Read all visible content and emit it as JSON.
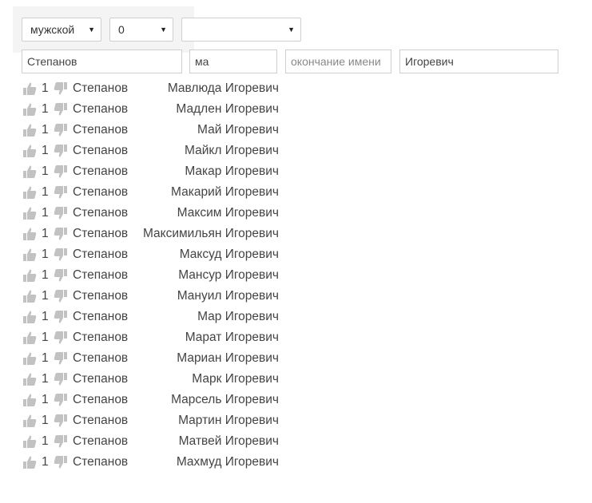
{
  "filters": {
    "gender": {
      "value": "мужской"
    },
    "count": {
      "value": "0"
    },
    "third": {
      "value": ""
    }
  },
  "inputs": {
    "surname": {
      "value": "Степанов"
    },
    "name_start": {
      "value": "ма"
    },
    "name_end": {
      "value": "",
      "placeholder": "окончание имени"
    },
    "patronymic": {
      "value": "Игоревич"
    }
  },
  "icons": {
    "like": "thumbs-up-icon",
    "dislike": "thumbs-down-icon",
    "dropdown": "chevron-down-icon"
  },
  "colors": {
    "icon": "#c2c2c2",
    "text": "#444444",
    "panel": "#f4f4f4"
  },
  "results": [
    {
      "votes": "1",
      "surname": "Степанов",
      "full_name": "Мавлюда Игоревич"
    },
    {
      "votes": "1",
      "surname": "Степанов",
      "full_name": "Мадлен Игоревич"
    },
    {
      "votes": "1",
      "surname": "Степанов",
      "full_name": "Май Игоревич"
    },
    {
      "votes": "1",
      "surname": "Степанов",
      "full_name": "Майкл Игоревич"
    },
    {
      "votes": "1",
      "surname": "Степанов",
      "full_name": "Макар Игоревич"
    },
    {
      "votes": "1",
      "surname": "Степанов",
      "full_name": "Макарий Игоревич"
    },
    {
      "votes": "1",
      "surname": "Степанов",
      "full_name": "Максим Игоревич"
    },
    {
      "votes": "1",
      "surname": "Степанов",
      "full_name": "Максимильян Игоревич"
    },
    {
      "votes": "1",
      "surname": "Степанов",
      "full_name": "Максуд Игоревич"
    },
    {
      "votes": "1",
      "surname": "Степанов",
      "full_name": "Мансур Игоревич"
    },
    {
      "votes": "1",
      "surname": "Степанов",
      "full_name": "Мануил Игоревич"
    },
    {
      "votes": "1",
      "surname": "Степанов",
      "full_name": "Мар Игоревич"
    },
    {
      "votes": "1",
      "surname": "Степанов",
      "full_name": "Марат Игоревич"
    },
    {
      "votes": "1",
      "surname": "Степанов",
      "full_name": "Мариан Игоревич"
    },
    {
      "votes": "1",
      "surname": "Степанов",
      "full_name": "Марк Игоревич"
    },
    {
      "votes": "1",
      "surname": "Степанов",
      "full_name": "Марсель Игоревич"
    },
    {
      "votes": "1",
      "surname": "Степанов",
      "full_name": "Мартин Игоревич"
    },
    {
      "votes": "1",
      "surname": "Степанов",
      "full_name": "Матвей Игоревич"
    },
    {
      "votes": "1",
      "surname": "Степанов",
      "full_name": "Махмуд Игоревич"
    }
  ]
}
